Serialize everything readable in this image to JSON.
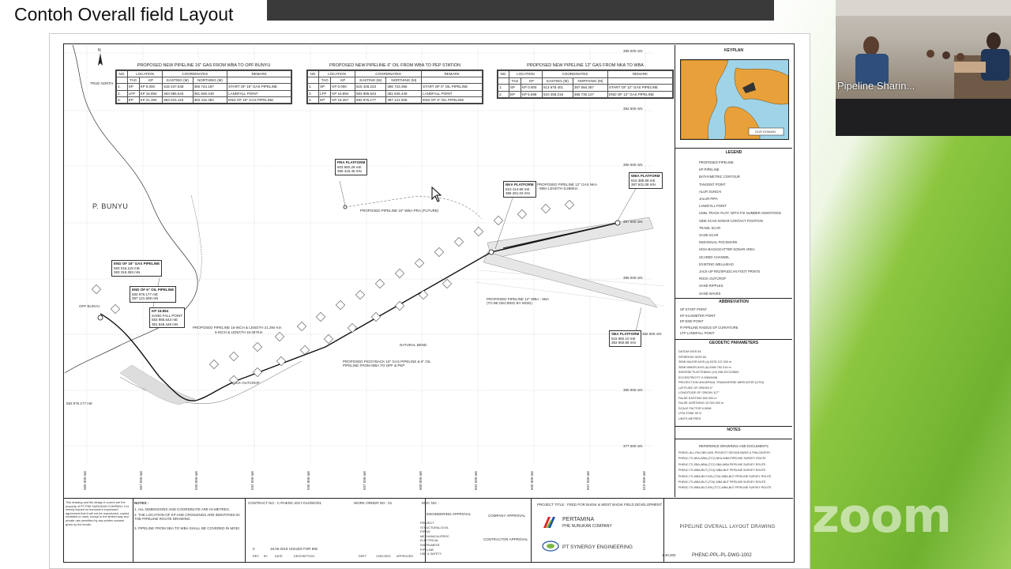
{
  "slide": {
    "title": "Contoh Overall field Layout"
  },
  "video": {
    "participant_name": "Pipeline Sharin..."
  },
  "zoom": {
    "logo_text": "zoom"
  },
  "drawing": {
    "north_label": "TRUE NORTH",
    "island_label": "P. BUNYU",
    "tables": [
      {
        "title": "PROPOSED NEW PIPELINE 16\" GAS FROM WBA TO OPF BUNYU",
        "header1": [
          "NO.",
          "LOCATION",
          "COORDINATES",
          "REMARK"
        ],
        "header2": [
          "TAG",
          "KP",
          "EASTING (M)",
          "NORTHING (M)"
        ],
        "rows": [
          [
            "1.",
            "SP",
            "KP 0.000",
            "615 437.648",
            "386 724.187",
            "START OF 16\" GAS PIPELINE"
          ],
          [
            "2.",
            "LFP",
            "KP 16.894",
            "583 985.643",
            "381 848.449",
            "LANDFALL POINT"
          ],
          [
            "3.",
            "EP",
            "KP 21.394",
            "583 016.118",
            "383 315.383",
            "END OF 16\" GAS PIPELINE"
          ]
        ]
      },
      {
        "title": "PROPOSED NEW PIPELINE 6\" OIL FROM WBA TO PEP STATION",
        "header1": [
          "NO.",
          "LOCATION",
          "COORDINATES",
          "REMARK"
        ],
        "header2": [
          "TAG",
          "KP",
          "EASTING (M)",
          "NORTHING (M)"
        ],
        "rows": [
          [
            "1.",
            "SP",
            "KP 0.000",
            "615 428.223",
            "386 723.356",
            "START OF 6\" OIL PIPELINE"
          ],
          [
            "2.",
            "LFP",
            "KP 16.894",
            "583 985.643",
            "381 848.449",
            "LANDFALL POINT"
          ],
          [
            "3.",
            "EP",
            "KP 19.357",
            "583 976.177",
            "387 121.508",
            "END OF 6\" OIL PIPELINE"
          ]
        ]
      },
      {
        "title": "PROPOSED NEW PIPELINE 12\" GAS FROM NKA TO WBA",
        "header1": [
          "NO.",
          "LOCATION",
          "COORDINATES",
          "REMARK"
        ],
        "header2": [
          "TAG",
          "KP",
          "EASTING (M)",
          "NORTHING (M)"
        ],
        "rows": [
          [
            "1.",
            "SP",
            "KP 0.000",
            "613 678.401",
            "387 594.357",
            "START OF 12\" GAS PIPELINE"
          ],
          [
            "2.",
            "EP",
            "KP 5.698",
            "610 458.218",
            "386 730.127",
            "END OF 12\" GAS PIPELINE"
          ]
        ]
      }
    ],
    "callouts": [
      {
        "head": "PRA PLATFORM",
        "l1": "603 682.28 mE",
        "l2": "386 416.45 mN"
      },
      {
        "head": "NKA PLATFORM",
        "l1": "610 414.68 mE",
        "l2": "386 261.03 mN"
      },
      {
        "head": "WBA PLATFORM",
        "l1": "615 385.89 mE",
        "l2": "387 631.08 mN"
      },
      {
        "head": "END OF 16\" GAS PIPELINE",
        "l1": "583 016.118 mE",
        "l2": "383 315.383 mN"
      },
      {
        "head": "END OF 6\" OIL PIPELINE",
        "l1": "583 976.177 mE",
        "l2": "387 121.508 mN"
      },
      {
        "head": "KP 16.894",
        "l1": "SAND FALL POINT",
        "l2": "583 985.643 mE",
        "l3": "381 848.449 mN"
      },
      {
        "head": "SBA PLATFORM",
        "l1": "615 982.10 mE",
        "l2": "383 960.88 mN"
      }
    ],
    "map_labels": {
      "pra_future": "PROPOSED PIPELINE 10\" WBA-PRA (FUTURE)",
      "pipe_16": "PROPOSED PIPELINE 16-INCH & LENGTH 21.394 Km",
      "pipe_6": "6-INCH & LENGTH 19.357Km",
      "piggyback": "PROPOSED PIGGYBACK 16\" GAS PIPELINE & 6\" OIL PIPELINE FROM WBA TO OPF & PEP",
      "nka_wba": "PROPOSED PIPELINE 12\" GAS NKA - WBA LENGTH 5.698Km",
      "sba": "PROPOSED PIPELINE 12\" WBA - SBA (TO BE DECIDED BY MGEI)",
      "rock": "ROCK OUTCROP",
      "natural_bend": "NATURAL BEND",
      "opf_bunyu": "OPF BUNYU",
      "coord_west": "583 976.177 mE"
    },
    "northings": [
      "395 000 mN",
      "392 500 mN",
      "390 000 mN",
      "387 500 mN",
      "385 000 mN",
      "382 500 mN",
      "380 000 mN",
      "377 500 mN"
    ],
    "eastings": [
      "585 000 mE",
      "587 500 mE",
      "590 000 mE",
      "592 500 mE",
      "595 000 mE",
      "597 500 mE",
      "600 000 mE",
      "602 500 mE",
      "605 000 mE",
      "607 500 mE",
      "610 000 mE",
      "612 500 mE",
      "615 000 mE",
      "617 500 mE",
      "620 000 mE"
    ],
    "sidebar": {
      "keyplan_title": "KEYPLAN",
      "keyplan_tag": "OUR DOMAIN",
      "legend_title": "LEGEND",
      "legend_items": [
        "PROPOSED PIPELINE",
        "KP PIPELINE",
        "BATHYMETRIC CONTOUR",
        "TANGENT POINT",
        "ALUR SUNGAI",
        "JALUR PIPA",
        "LANDFALL POINT",
        "USBL TRACK PLOT, WITH FIX NUMBER ANNOTATED",
        "SIDE SCAN SONAR CONTACT POSITION",
        "TRAWL SCAR",
        "SAND SCAR",
        "INDIVIDUAL POCKMARK",
        "HIGH BACKSCATTER SONAR AREA",
        "SCARED CHANNEL",
        "EXISTING WELLHEAD",
        "JACK-UP RIG/SPUDCAN FOOT PRINTS",
        "ROCK OUTCROP",
        "SAND RIPPLES",
        "SAND WAVES"
      ],
      "abbr_title": "ABBREVIATION",
      "abbr_items": [
        "SP    START POINT",
        "KP    KILOMETER POINT",
        "EP    END POINT",
        "R     PIPELINE RADIUS OF CURVATURE",
        "LFP   LANDFALL POINT"
      ],
      "geo_title": "GEODETIC PARAMETERS",
      "geo_items": [
        "DATUM              WGS 84",
        "SPHEROID           WGS 84",
        "SEMI MAJOR AXIS (a)  6378 137.000 m",
        "SEMI MINOR AXIS (b)  6356 752.314 m",
        "INVERSE FLATTENING (1/f) 298.257223563",
        "ECCENTRICITY       0.00669438",
        "PROJECTION         UNIVERSAL TRANSVERSE MERCATOR (UTM)",
        "LATITUDE OF ORIGIN  0°",
        "LONGITUDE OF ORIGIN 117°",
        "FALSE EASTING      500 000 m",
        "FALSE NORTHING     10 000 000 m",
        "SCALE FACTOR       0.9996",
        "UTM ZONE           50 N",
        "UNITS              METRES"
      ],
      "notes_title": "NOTES",
      "ref_title": "REFERENCE DRAWINGS AND DOCUMENTS",
      "ref_items": [
        "PHENC-ALL-PM-OBS-0001   PROJECT DESIGN BASIS & PHILOSOPHY",
        "PHENC-TS-NKA-WBA-(TC2)   NKA-WBA PIPELINE SURVEY ROUTE",
        "PHENC-TS-SBA-WBA-(TC2)   SBA-WBA PIPELINE SURVEY ROUTE",
        "PHENC-TS-WBA-BUT-(TC4)   WBA-BUT PIPELINE SURVEY ROUTE",
        "PHENC-TS-WBA-BUT-KIN-(TC5)  WBA-BUT PIPELINE SURVEY ROUTE",
        "PHENC-TS-WBA-BUT-(TC6)   WBA-BUT PIPELINE SURVEY ROUTE",
        "PHENC-TS-WBA-BUT-KIN-(TC7)  WBA-BUT PIPELINE SURVEY ROUTE"
      ]
    },
    "titleblock": {
      "disclaimer": "This drawing and the design it covers are the property of PT PHE NUNUKAN COMPANY. It is merely loaned on borrower's expressed agreement that it will not be reproduced, copied, exhibited or used, except in the limited way and private use permitted by any written consent given by the lender.",
      "notes_head": "NOTES :",
      "notes": [
        "1. ALL DIMENSIONS AND COORDINATE ARE IN METRES.",
        "2. THE LOCATION OF KP AND CROSSINGS ARE IDENTIFIED IN THE PIPELINE ROUTE DRAWING.",
        "3. PIPELINE FROM SBA TO WBA SHALL BE COVERED IN MGEI"
      ],
      "contract": "CONTRACT NO : C-PHENC-2017-012/WO/01",
      "work_order": "WORK ORDER NO : 01",
      "moc": "MOC NO. :",
      "project": "PROJECT TITLE : FEED FOR BADIK & WEST BADIK FIELD DEVELOPMENT",
      "company1": "PERTAMINA",
      "company1_sub": "PHE NUNUKAN COMPANY",
      "company2": "PT SYNERGY ENGINEERING",
      "drawing_title": "PIPELINE OVERALL LAYOUT DRAWING",
      "drawing_no": "PHENC-PPL-PL-DWG-1002",
      "scale": "1:40,000",
      "rev": "0",
      "rev_date": "18.06.2018",
      "rev_desc": "ISSUED FOR BID",
      "discipline": [
        "PROJECT",
        "STRUCTURAL/CIVIL",
        "PIPING",
        "MECHANICAL/PROC",
        "ELECTRICAL",
        "INSTRUMENT",
        "PIPELINE",
        "HSE & SAFETY"
      ],
      "col_heads": [
        "REV",
        "BY",
        "DATE",
        "DESCRIPTION",
        "DRFT",
        "CHECKED",
        "APPROVED"
      ],
      "engineering_approval": "ENGINEERING APPROVAL",
      "company_approval": "COMPANY APPROVAL",
      "contractor_approval": "CONTRACTOR APPROVAL"
    }
  }
}
